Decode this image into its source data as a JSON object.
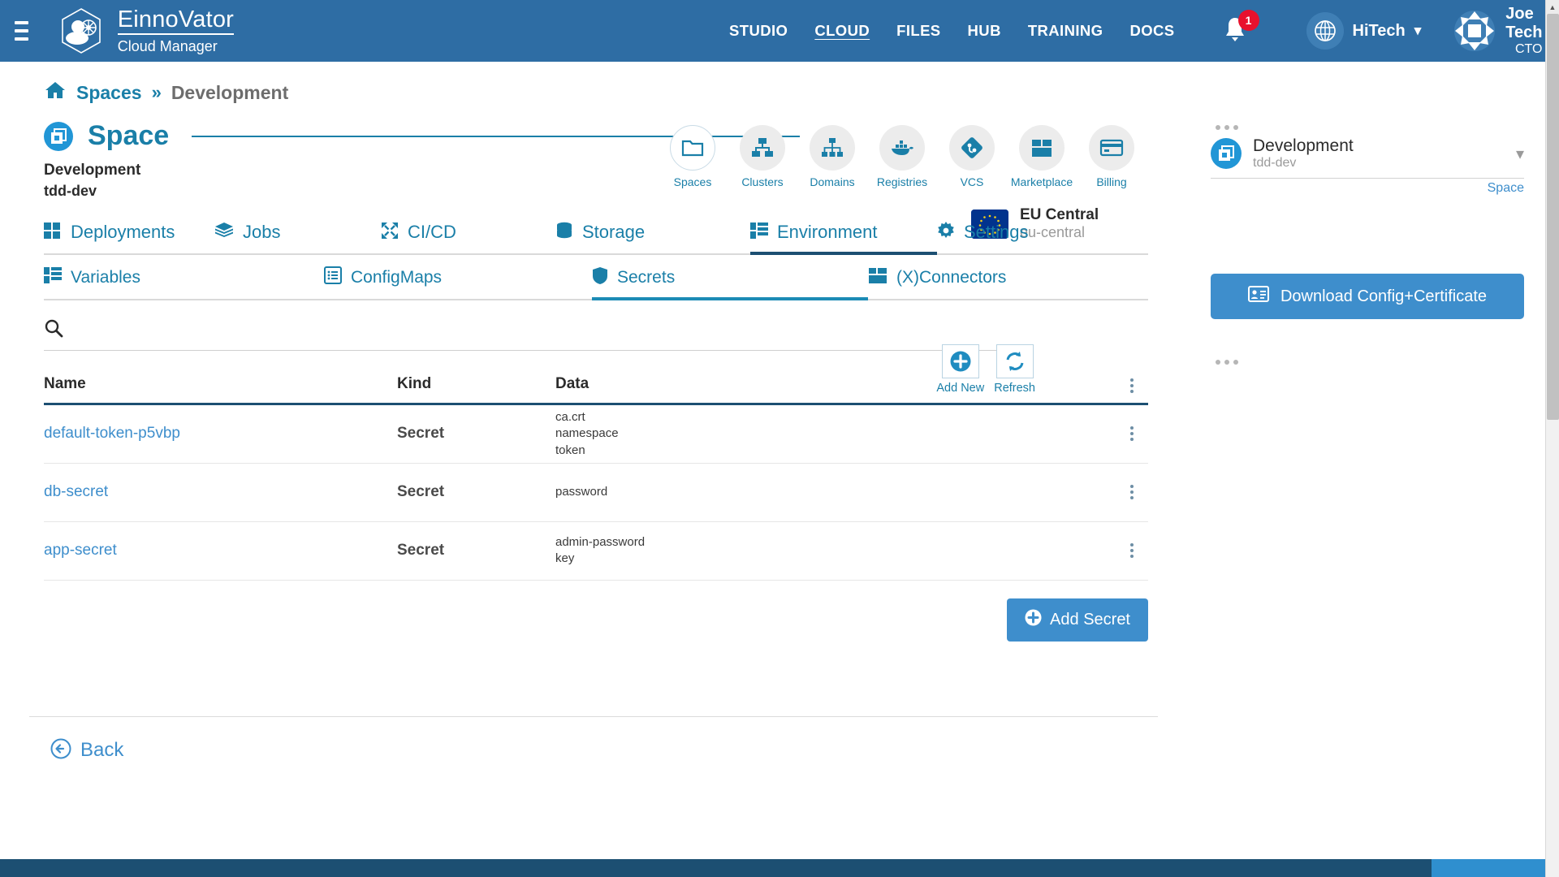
{
  "header": {
    "brand_name": "EinnoVator",
    "brand_sub": "Cloud Manager",
    "menu_icon": "hamburger-icon",
    "nav": [
      {
        "label": "STUDIO",
        "active": false
      },
      {
        "label": "CLOUD",
        "active": true
      },
      {
        "label": "FILES",
        "active": false
      },
      {
        "label": "HUB",
        "active": false
      },
      {
        "label": "TRAINING",
        "active": false
      },
      {
        "label": "DOCS",
        "active": false
      }
    ],
    "notifications_count": "1",
    "org": "HiTech",
    "user_name": "Joe Tech",
    "user_role": "CTO"
  },
  "breadcrumb": {
    "home_icon": "home-icon",
    "root": "Spaces",
    "separator": "»",
    "current": "Development"
  },
  "page": {
    "title": "Space",
    "space_name": "Development",
    "space_id": "tdd-dev"
  },
  "region": {
    "name": "EU Central",
    "code": "eu-central"
  },
  "toolbar": [
    {
      "label": "Spaces",
      "icon": "folder-icon",
      "active": true
    },
    {
      "label": "Clusters",
      "icon": "cluster-nodes-icon",
      "active": false
    },
    {
      "label": "Domains",
      "icon": "sitemap-icon",
      "active": false
    },
    {
      "label": "Registries",
      "icon": "docker-whale-icon",
      "active": false
    },
    {
      "label": "VCS",
      "icon": "git-diamond-icon",
      "active": false
    },
    {
      "label": "Marketplace",
      "icon": "box-open-icon",
      "active": false
    },
    {
      "label": "Billing",
      "icon": "credit-card-icon",
      "active": false
    }
  ],
  "tabs": [
    {
      "label": "Deployments",
      "icon": "grid-icon",
      "active": false
    },
    {
      "label": "Jobs",
      "icon": "layers-icon",
      "active": false
    },
    {
      "label": "CI/CD",
      "icon": "compress-arrows-icon",
      "active": false
    },
    {
      "label": "Storage",
      "icon": "database-icon",
      "active": false
    },
    {
      "label": "Environment",
      "icon": "table-list-icon",
      "active": true
    },
    {
      "label": "Settings",
      "icon": "gear-icon",
      "active": false
    }
  ],
  "subtabs": [
    {
      "label": "Variables",
      "icon": "table-list-icon",
      "active": false
    },
    {
      "label": "ConfigMaps",
      "icon": "list-box-icon",
      "active": false
    },
    {
      "label": "Secrets",
      "icon": "shield-icon",
      "active": true
    },
    {
      "label": "(X)Connectors",
      "icon": "box-open-icon",
      "active": false
    }
  ],
  "search": {
    "placeholder": "",
    "value": "",
    "icon": "search-icon"
  },
  "actions": [
    {
      "label": "Add New",
      "icon": "plus-circle-icon"
    },
    {
      "label": "Refresh",
      "icon": "refresh-icon"
    }
  ],
  "table": {
    "columns": [
      "Name",
      "Kind",
      "Data"
    ],
    "rows": [
      {
        "name": "default-token-p5vbp",
        "kind": "Secret",
        "data": "ca.crt\nnamespace\ntoken"
      },
      {
        "name": "db-secret",
        "kind": "Secret",
        "data": "password"
      },
      {
        "name": "app-secret",
        "kind": "Secret",
        "data": "admin-password\nkey"
      }
    ]
  },
  "add_secret_label": "Add Secret",
  "back_label": "Back",
  "rail": {
    "card_title": "Development",
    "card_sub": "tdd-dev",
    "card_tag": "Space",
    "download_label": "Download Config+Certificate"
  },
  "colors": {
    "header_blue": "#2e6da4",
    "teal": "#1a7fa8",
    "link_blue": "#3e8ecc",
    "dark_blue": "#1c4f72",
    "badge_red": "#e8112d",
    "eu_flag_blue": "#01338d"
  }
}
